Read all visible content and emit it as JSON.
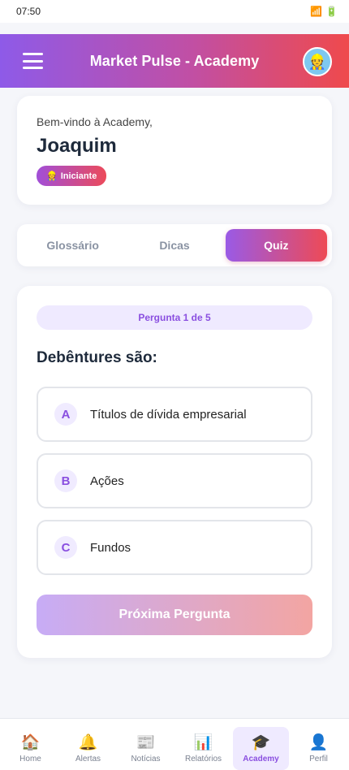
{
  "status_bar": {
    "time": "07:50",
    "signal_icon": "📶",
    "battery_icon": "🔋"
  },
  "header": {
    "title": "Market Pulse - Academy",
    "avatar_icon": "👷"
  },
  "welcome": {
    "greeting": "Bem-vindo à Academy,",
    "name": "Joaquim",
    "level_icon": "👷",
    "level": "Iniciante"
  },
  "tabs": [
    {
      "label": "Glossário",
      "active": false
    },
    {
      "label": "Dicas",
      "active": false
    },
    {
      "label": "Quiz",
      "active": true
    }
  ],
  "quiz": {
    "progress": "Pergunta 1 de 5",
    "question": "Debêntures são:",
    "options": [
      {
        "letter": "A",
        "text": "Títulos de dívida empresarial"
      },
      {
        "letter": "B",
        "text": "Ações"
      },
      {
        "letter": "C",
        "text": "Fundos"
      }
    ],
    "next_label": "Próxima Pergunta"
  },
  "nav": [
    {
      "label": "Home",
      "icon": "🏠",
      "active": false
    },
    {
      "label": "Alertas",
      "icon": "🔔",
      "active": false
    },
    {
      "label": "Notícias",
      "icon": "📰",
      "active": false
    },
    {
      "label": "Relatórios",
      "icon": "📊",
      "active": false
    },
    {
      "label": "Academy",
      "icon": "🎓",
      "active": true
    },
    {
      "label": "Perfil",
      "icon": "👤",
      "active": false
    }
  ],
  "colors": {
    "brand_start": "#8e5ae8",
    "brand_end": "#ef4a4c",
    "accent": "#8a4fe0"
  }
}
